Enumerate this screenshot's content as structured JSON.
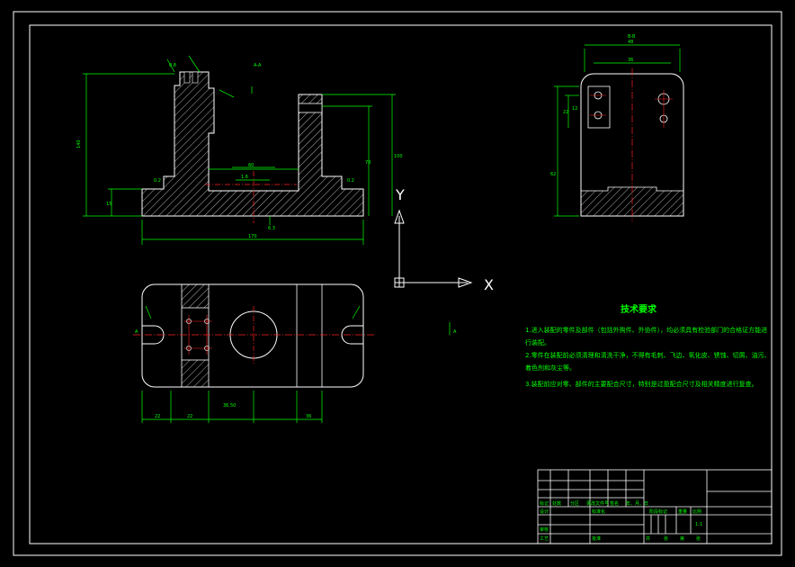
{
  "colors": {
    "background": "#000000",
    "frame": "#ffffff",
    "part": "#ffffff",
    "dimension": "#00ff00",
    "centerline": "#ff2020",
    "hatch": "#ffffff",
    "text": "#00ff00"
  },
  "ucs": {
    "x_label": "X",
    "y_label": "Y"
  },
  "views": {
    "section_label": "A-A",
    "side_view_label": "B-B",
    "front_dims": {
      "height_total": "140",
      "overall_width": "170",
      "base_height": "15",
      "left_top": "0.8",
      "right_height": "100",
      "mid_height": "78",
      "slot_width": "60",
      "slot_depth": "1.6",
      "chamfer_left": "0.2",
      "chamfer_right": "0.2",
      "bottom_surface": "6.3"
    },
    "plan_dims": {
      "dim_a": "22",
      "dim_b": "22",
      "dim_c": "36.50",
      "dim_d": "36",
      "ref": "A"
    },
    "side_dims": {
      "top_width": "48",
      "inner_width": "36",
      "dim_a": "22",
      "dim_b": "12",
      "dim_c": "62"
    }
  },
  "tech_requirements": {
    "title": "技术要求",
    "items": [
      "1.进入装配的零件及部件（包括外购件、外协件），均必须具有检验部门的合格证方能进行装配。",
      "2.零件在装配前必须清理和清洗干净，不得有毛刺、飞边、氧化皮、锈蚀、切屑、油污、着色剂和灰尘等。",
      "3.装配前应对零、部件的主要配合尺寸，特别是过盈配合尺寸及相关精度进行复查。"
    ]
  },
  "title_block": {
    "row_marks": "标记",
    "row_count": "处数",
    "row_zone": "分区",
    "row_change_no": "更改文件号",
    "row_sign": "签名",
    "row_date": "年、月、日",
    "design": "设计",
    "standardize": "标准化",
    "stage_mark": "阶段标记",
    "weight": "重量",
    "scale": "比例",
    "scale_value": "1:1",
    "review": "审核",
    "process": "工艺",
    "approve": "批准",
    "total": "共",
    "sheet": "张",
    "page": "第",
    "page_sheet": "张"
  }
}
